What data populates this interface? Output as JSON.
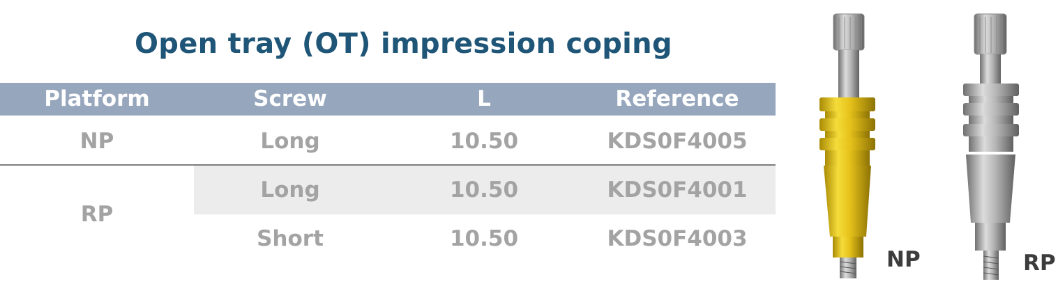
{
  "title": "Open tray (OT) impression coping",
  "table": {
    "headers": [
      "Platform",
      "Screw",
      "L",
      "Reference"
    ],
    "rows": [
      {
        "platform": "NP",
        "screw": "Long",
        "l": "10.50",
        "reference": "KDS0F4005"
      },
      {
        "platform": "RP",
        "screw": "Long",
        "l": "10.50",
        "reference": "KDS0F4001"
      },
      {
        "platform": "",
        "screw": "Short",
        "l": "10.50",
        "reference": "KDS0F4003"
      }
    ]
  },
  "products": [
    {
      "label": "NP",
      "color": "#e6c21a"
    },
    {
      "label": "RP",
      "color": "#a9a9a9"
    }
  ],
  "colors": {
    "title": "#1f5577",
    "header_bg": "#96a6bc",
    "cell_text": "#a3a3a3",
    "shade": "#ececec"
  }
}
